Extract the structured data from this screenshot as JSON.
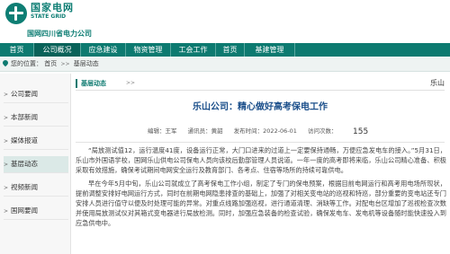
{
  "header": {
    "logo_cn": "国家电网",
    "logo_en": "STATE GRID",
    "company": "国网四川省电力公司"
  },
  "nav": [
    {
      "label": "首页",
      "active": false
    },
    {
      "label": "公司概况",
      "active": true
    },
    {
      "label": "应急建设",
      "active": false
    },
    {
      "label": "物资管理",
      "active": false
    },
    {
      "label": "工会工作",
      "active": false
    },
    {
      "label": "首页",
      "active": false
    },
    {
      "label": "基建管理",
      "active": false
    }
  ],
  "breadcrumb": {
    "prefix": "您的位置：",
    "items": [
      "首页",
      "基层动态"
    ]
  },
  "sidebar": {
    "items": [
      {
        "label": "公司要闻",
        "active": false
      },
      {
        "label": "本部新闻",
        "active": false
      },
      {
        "label": "媒体报道",
        "active": false
      },
      {
        "label": "基层动态",
        "active": true
      },
      {
        "label": "视频新闻",
        "active": false
      },
      {
        "label": "国网要闻",
        "active": false
      }
    ]
  },
  "content": {
    "section_label": "基层动态",
    "right_text": "乐山",
    "title": "乐山公司：精心做好高考保电工作",
    "meta": {
      "editor": "编辑：王军",
      "source": "通讯员：黄韶",
      "date": "发布时间：2022-06-01",
      "views_label": "访问次数：",
      "views": "155"
    },
    "paragraphs": [
      "“局放测试值12，运行温度41度，设备运行正常，大门口进来的过道上一定要保持通畅，万便应急发电车的接入。”5月31日，乐山市外国语学校，国网乐山供电公司保电人员向该校后勤部管理人员说道。一年一度的高考即将来临，乐山公司精心准备、积极采取有效措施，确保考试期间电网安全运行及教育部门、各考点、住宿等场所的持续可靠供电。",
      "早在今年5月中旬，乐山公司就成立了高考保电工作小组，制定了专门的保电预案，根据目前电网运行和高考用电场所现状，提前调整安排好电网运行方式，同时在前期电网隐患排查的基础上，加强了对相关变电站的巡视和特巡，部分重要的变电站还专门安排人员进行值守以便及时处理可能的异常。对重点线路加强巡视，进行通道清理、消缺等工作。对配电台区增加了巡视检查次数并使用局放测试仪对其箱式变电器进行局放检测。同时，加强应急装备的检查试验，确保发电车、发电机等设备随时能快速投入到应急供电中。"
    ]
  }
}
